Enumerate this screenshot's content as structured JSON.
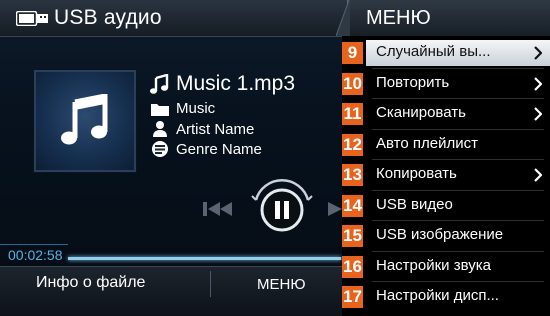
{
  "header": {
    "source_title": "USB аудио",
    "usb_icon": "usb-drive-icon",
    "menu_title": "МЕНЮ"
  },
  "track": {
    "title": "Music 1.mp3",
    "folder": "Music",
    "artist": "Artist Name",
    "genre": "Genre Name",
    "title_icon": "music-note-icon",
    "folder_icon": "folder-icon",
    "artist_icon": "person-icon",
    "genre_icon": "genre-disc-icon"
  },
  "playback": {
    "elapsed": "00:02:58",
    "progress_fraction": 0.98,
    "state": "playing",
    "controls": [
      "previous",
      "pause",
      "next"
    ]
  },
  "bottom_tabs": {
    "file_info": "Инфо о файле",
    "menu": "МЕНЮ"
  },
  "menu": {
    "items": [
      {
        "num": "9",
        "label": "Случайный вы...",
        "chevron": true,
        "selected": true
      },
      {
        "num": "10",
        "label": "Повторить",
        "chevron": true,
        "selected": false
      },
      {
        "num": "11",
        "label": "Сканировать",
        "chevron": true,
        "selected": false
      },
      {
        "num": "12",
        "label": "Авто плейлист",
        "chevron": false,
        "selected": false
      },
      {
        "num": "13",
        "label": "Копировать",
        "chevron": true,
        "selected": false
      },
      {
        "num": "14",
        "label": "USB видео",
        "chevron": false,
        "selected": false
      },
      {
        "num": "15",
        "label": "USB изображение",
        "chevron": false,
        "selected": false
      },
      {
        "num": "16",
        "label": "Настройки звука",
        "chevron": false,
        "selected": false
      },
      {
        "num": "17",
        "label": "Настройки дисп...",
        "chevron": false,
        "selected": false
      }
    ]
  },
  "colors": {
    "accent_orange": "#e8641e",
    "progress_blue": "#8fcff0",
    "time_blue": "#4fb3e0",
    "highlight": "#e6eaee"
  }
}
